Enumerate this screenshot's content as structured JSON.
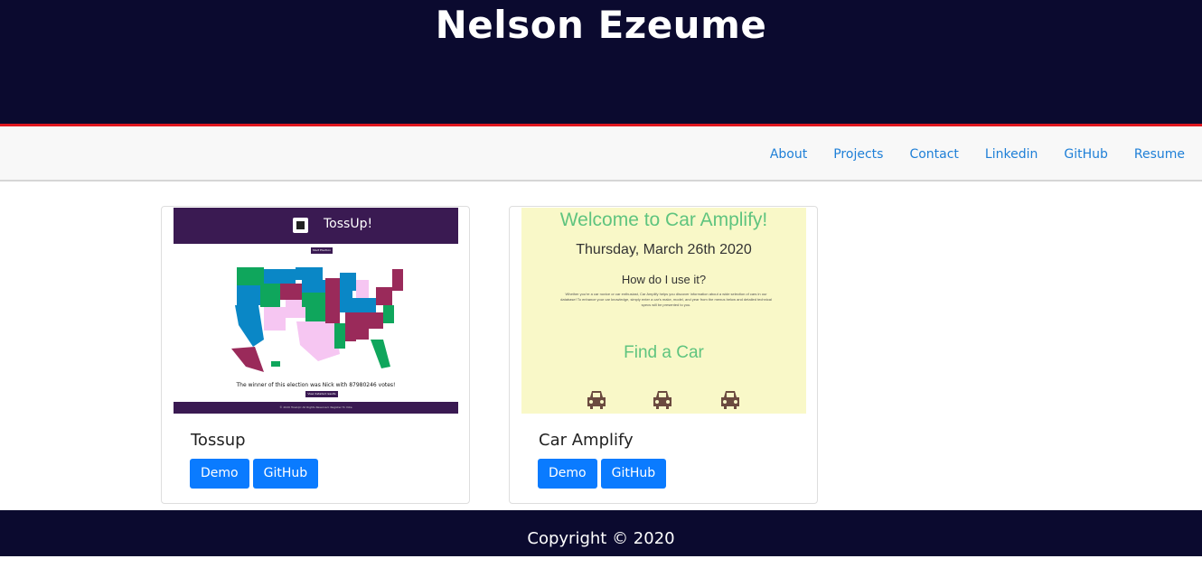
{
  "header": {
    "title": "Nelson Ezeume"
  },
  "nav": {
    "items": [
      "About",
      "Projects",
      "Contact",
      "Linkedin",
      "GitHub",
      "Resume"
    ]
  },
  "projects": [
    {
      "title": "Tossup",
      "demo_label": "Demo",
      "github_label": "GitHub",
      "thumbnail": {
        "app_name": "TossUp!",
        "button1": "Start Election",
        "caption": "The winner of this election was Nick with 87980246 votes!",
        "button2": "View detailed results",
        "footer": "© 2020 TossUp! All Rights Reserved.   Register To Vote"
      }
    },
    {
      "title": "Car Amplify",
      "demo_label": "Demo",
      "github_label": "GitHub",
      "thumbnail": {
        "heading": "Welcome to Car Amplify!",
        "date": "Thursday, March 26th 2020",
        "subheading": "How do I use it?",
        "body": "Whether you're a car novice or car enthusiast, Car Amplify helps you discover information about a wide selection of cars in our database! To enhance your car knowledge, simply enter a car's make, model, and year from the menus below and detailed technical specs will be presented to you.",
        "cta": "Find a Car"
      }
    }
  ],
  "footer": {
    "text": "Copyright © 2020"
  },
  "colors": {
    "header_bg": "#0b0a2f",
    "accent_line": "#e0171f",
    "nav_link": "#1e7fd7",
    "button_bg": "#0a7bff"
  }
}
